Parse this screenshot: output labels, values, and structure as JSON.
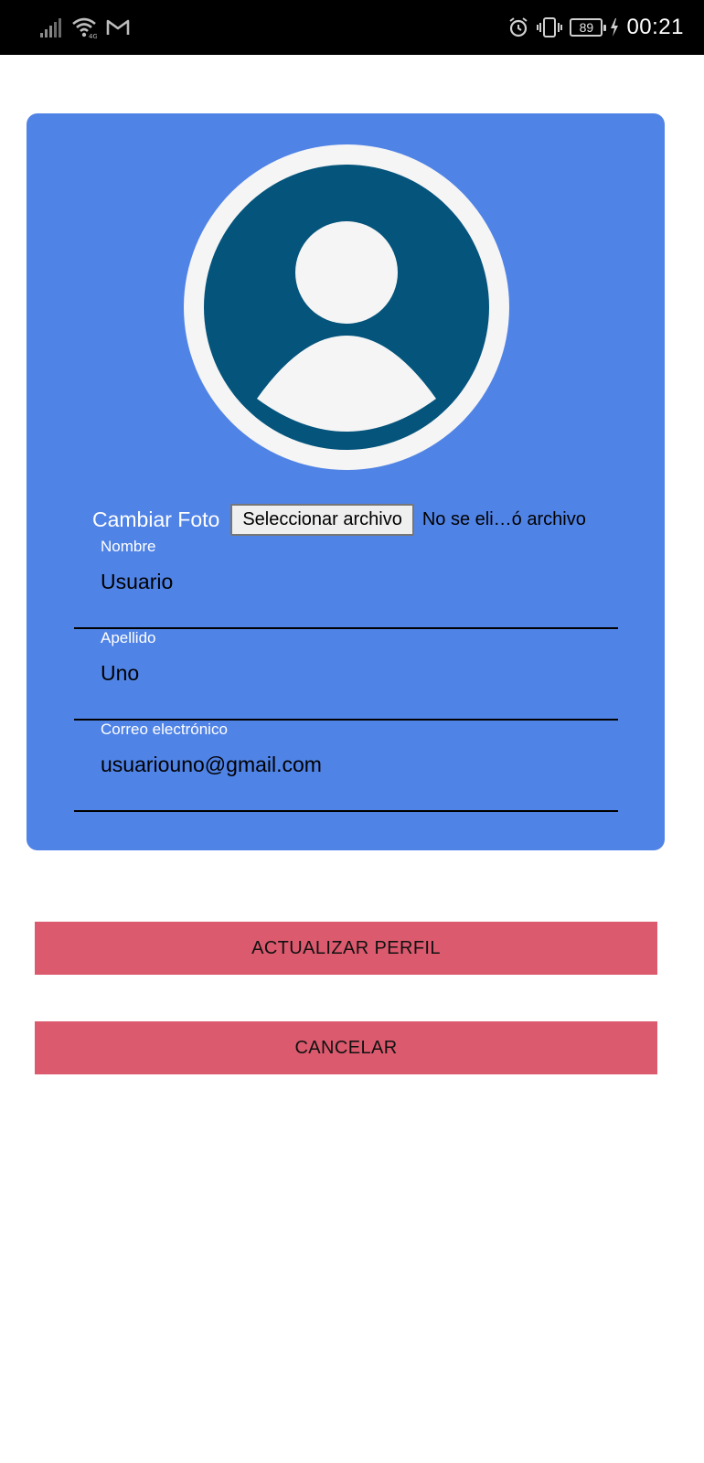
{
  "status_bar": {
    "time": "00:21",
    "battery": "89",
    "icons": [
      "signal-icon",
      "wifi-icon",
      "gmail-icon",
      "alarm-icon",
      "vibrate-icon",
      "battery-icon",
      "charging-icon"
    ]
  },
  "profile": {
    "change_photo_label": "Cambiar Foto",
    "file_button_label": "Seleccionar archivo",
    "file_status": "No se eli…ó archivo",
    "avatar_icon": "user-avatar-icon",
    "fields": [
      {
        "label": "Nombre",
        "value": "Usuario"
      },
      {
        "label": "Apellido",
        "value": "Uno"
      },
      {
        "label": "Correo electrónico",
        "value": "usuariouno@gmail.com"
      }
    ]
  },
  "actions": {
    "update_label": "ACTUALIZAR PERFIL",
    "cancel_label": "CANCELAR"
  },
  "colors": {
    "card_background": "#5083e6",
    "avatar_dark": "#04547c",
    "avatar_light": "#f5f5f5",
    "button_background": "#db5a6e",
    "status_bar": "#000000"
  }
}
